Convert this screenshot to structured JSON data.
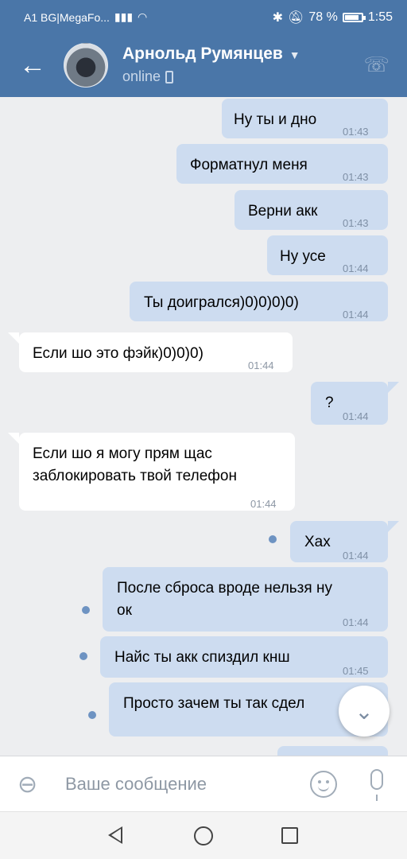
{
  "statusbar": {
    "carrier": "A1 BG|MegaFo...",
    "battery": "78 %",
    "battery_level": 0.78,
    "time": "1:55"
  },
  "header": {
    "name": "Арнольд Румянцев",
    "status": "online"
  },
  "messages": [
    {
      "dir": "out",
      "text": "Ну ты и дно",
      "time": "01:43"
    },
    {
      "dir": "out",
      "text": "Форматнул меня",
      "time": "01:43"
    },
    {
      "dir": "out",
      "text": "Верни акк",
      "time": "01:43"
    },
    {
      "dir": "out",
      "text": "Ну усе",
      "time": "01:44"
    },
    {
      "dir": "out",
      "text": "Ты доигрался)0)0)0)0)",
      "time": "01:44"
    },
    {
      "dir": "in",
      "text": "Если шо это фэйк)0)0)0)",
      "time": "01:44"
    },
    {
      "dir": "out",
      "text": "?",
      "time": "01:44"
    },
    {
      "dir": "in",
      "text": "Если шо я могу прям щас\nзаблокировать твой телефон",
      "time": "01:44"
    },
    {
      "dir": "out",
      "text": "Хах",
      "time": "01:44",
      "unread": true
    },
    {
      "dir": "out",
      "text": "После сброса вроде нельзя ну\nок",
      "time": "01:44",
      "unread": true
    },
    {
      "dir": "out",
      "text": "Найс ты акк спиздил кнш",
      "time": "01:45",
      "unread": true
    },
    {
      "dir": "out",
      "text": "Просто зачем ты так сдел",
      "time": "",
      "unread": true
    }
  ],
  "composer": {
    "placeholder": "Ваше сообщение"
  },
  "icons": {
    "back": "arrow-left-icon",
    "call": "phone-icon",
    "attach": "paperclip-icon",
    "emoji": "smile-icon",
    "voice": "microphone-icon",
    "scroll_down": "chevron-down-icon"
  }
}
